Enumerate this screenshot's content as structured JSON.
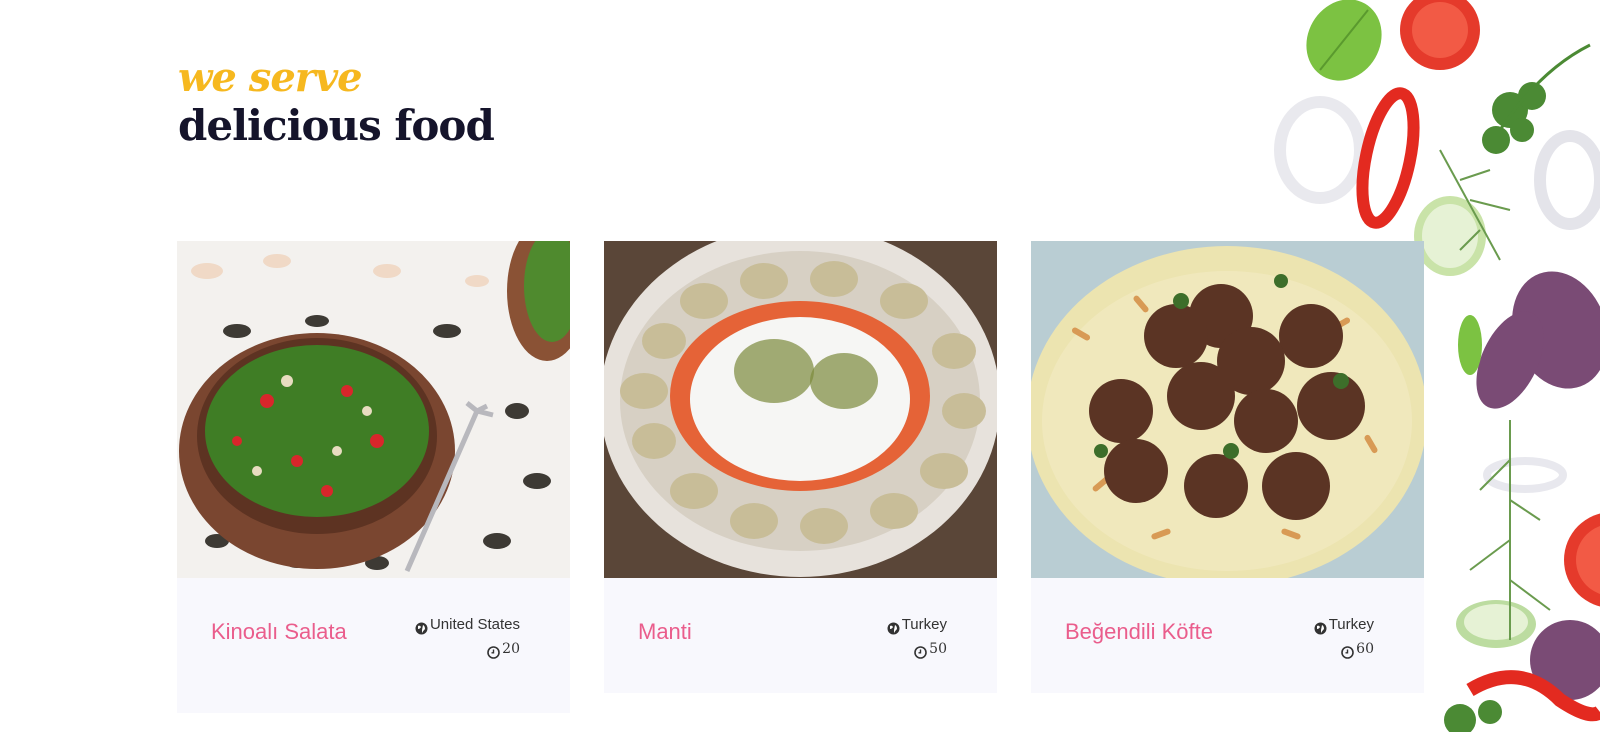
{
  "section": {
    "subtitle": "we serve",
    "title": "delicious food"
  },
  "cards": [
    {
      "title": "Kinoalı Salata",
      "country": "United States",
      "time": "20",
      "image": "quinoa-salad-photo"
    },
    {
      "title": "Manti",
      "country": "Turkey",
      "time": "50",
      "image": "manti-dumplings-photo"
    },
    {
      "title": "Beğendili Köfte",
      "country": "Turkey",
      "time": "60",
      "image": "kofte-meatballs-photo"
    }
  ],
  "colors": {
    "accent": "#f6b81f",
    "title": "#15142b",
    "card_title": "#ea5d8c",
    "card_bg": "#f8f8fd"
  }
}
